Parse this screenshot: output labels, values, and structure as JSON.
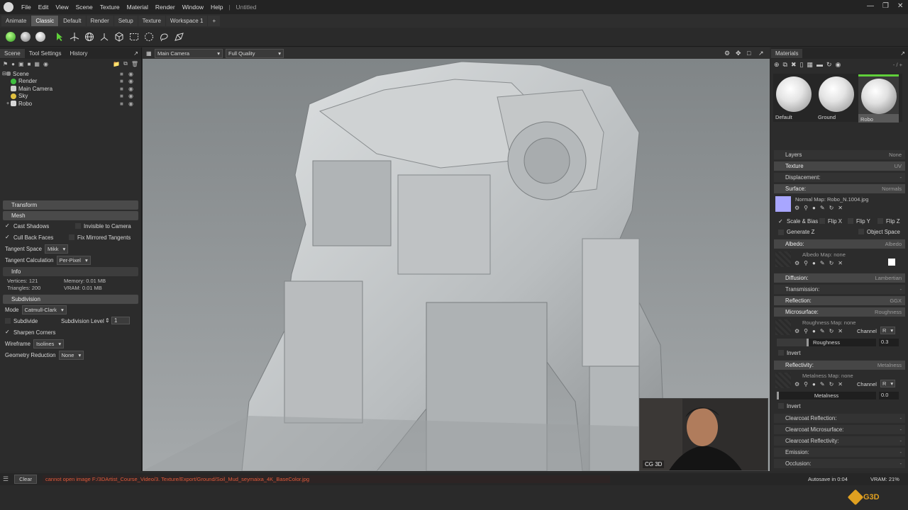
{
  "titlebar": {
    "menus": [
      "File",
      "Edit",
      "View",
      "Scene",
      "Texture",
      "Material",
      "Render",
      "Window",
      "Help"
    ],
    "doc": "Untitled"
  },
  "tabs": [
    "Animate",
    "Classic",
    "Default",
    "Render",
    "Setup",
    "Texture",
    "Workspace 1",
    "+"
  ],
  "left": {
    "tabs": [
      "Scene",
      "Tool Settings",
      "History"
    ],
    "tree": [
      "Scene",
      "Render",
      "Main Camera",
      "Sky",
      "Robo"
    ],
    "transform": "Transform",
    "mesh": {
      "title": "Mesh",
      "cast_shadows": "Cast Shadows",
      "invisible": "Invisible to Camera",
      "cull": "Cull Back Faces",
      "fix_mirrored": "Fix Mirrored Tangents",
      "tangent_space_label": "Tangent Space",
      "tangent_space": "Mikk",
      "tangent_calc_label": "Tangent Calculation",
      "tangent_calc": "Per-Pixel"
    },
    "info": {
      "title": "Info",
      "vertices": "Vertices:  121",
      "triangles": "Triangles:  200",
      "memory": "Memory:  0.01 MB",
      "vram": "VRAM:  0.01 MB"
    },
    "subdivision": {
      "title": "Subdivision",
      "mode_label": "Mode",
      "mode": "Catmull-Clark",
      "subdivide": "Subdivide",
      "level_label": "Subdivision Level",
      "level": "1",
      "sharpen": "Sharpen Corners",
      "wireframe_label": "Wireframe",
      "wireframe": "Isolines",
      "geo_label": "Geometry Reduction",
      "geo": "None"
    }
  },
  "viewport": {
    "camera": "Main Camera",
    "quality": "Full Quality"
  },
  "webcam": {
    "label": "CG 3D"
  },
  "right": {
    "title": "Materials",
    "counter": "- / +",
    "materials": [
      "Default",
      "Ground",
      "Robo"
    ],
    "layers": {
      "label": "Layers",
      "value": "None"
    },
    "texture": {
      "label": "Texture",
      "value": "UV"
    },
    "displacement": {
      "label": "Displacement:",
      "value": "-"
    },
    "surface": {
      "label": "Surface:",
      "value": "Normals",
      "map": "Normal Map: Robo_N.1004.jpg",
      "scale_bias": "Scale & Bias",
      "flipx": "Flip X",
      "flipy": "Flip Y",
      "flipz": "Flip Z",
      "genz": "Generate Z",
      "objspace": "Object Space"
    },
    "albedo": {
      "label": "Albedo:",
      "value": "Albedo",
      "map": "Albedo Map: none"
    },
    "diffusion": {
      "label": "Diffusion:",
      "value": "Lambertian"
    },
    "transmission": {
      "label": "Transmission:",
      "value": "-"
    },
    "reflection": {
      "label": "Reflection:",
      "value": "GGX"
    },
    "micro": {
      "label": "Microsurface:",
      "value": "Roughness",
      "map": "Roughness Map: none",
      "channel": "Channel",
      "ch": "R",
      "slider": "Roughness",
      "slider_val": "0.3",
      "invert": "Invert"
    },
    "reflectivity": {
      "label": "Reflectivity:",
      "value": "Metalness",
      "map": "Metalness Map: none",
      "channel": "Channel",
      "ch": "R",
      "slider": "Metalness",
      "slider_val": "0.0",
      "invert": "Invert"
    },
    "more": [
      {
        "label": "Clearcoat Reflection:",
        "value": "-"
      },
      {
        "label": "Clearcoat Microsurface:",
        "value": "-"
      },
      {
        "label": "Clearcoat Reflectivity:",
        "value": "-"
      },
      {
        "label": "Emission:",
        "value": "-"
      },
      {
        "label": "Occlusion:",
        "value": "-"
      }
    ]
  },
  "status": {
    "clear": "Clear",
    "error": "cannot open image F:/3DArtist_Course_Video/3. Texture/Export/Ground/Soil_Mud_seymaixa_4K_BaseColor.jpg",
    "autosave": "Autosave in 0:04",
    "vram": "VRAM: 21%"
  },
  "brand": "G3D"
}
